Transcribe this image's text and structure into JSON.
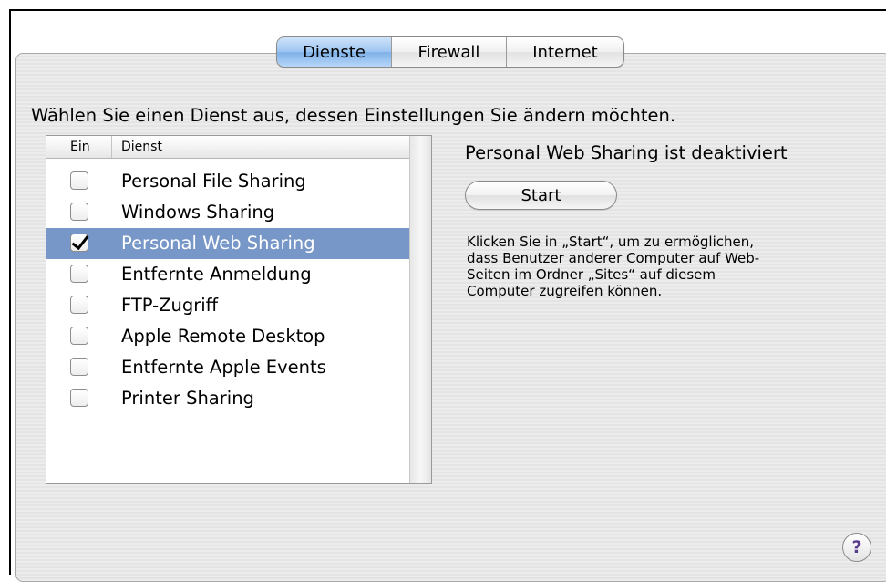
{
  "tabs": [
    {
      "label": "Dienste",
      "active": true
    },
    {
      "label": "Firewall",
      "active": false
    },
    {
      "label": "Internet",
      "active": false
    }
  ],
  "heading": "Wählen Sie einen Dienst aus, dessen Einstellungen Sie ändern möchten.",
  "list": {
    "columns": {
      "on": "Ein",
      "service": "Dienst"
    },
    "items": [
      {
        "label": "Personal File Sharing",
        "checked": false,
        "selected": false
      },
      {
        "label": "Windows Sharing",
        "checked": false,
        "selected": false
      },
      {
        "label": "Personal Web Sharing",
        "checked": true,
        "selected": true
      },
      {
        "label": "Entfernte Anmeldung",
        "checked": false,
        "selected": false
      },
      {
        "label": "FTP-Zugriff",
        "checked": false,
        "selected": false
      },
      {
        "label": "Apple Remote Desktop",
        "checked": false,
        "selected": false
      },
      {
        "label": "Entfernte Apple Events",
        "checked": false,
        "selected": false
      },
      {
        "label": "Printer Sharing",
        "checked": false,
        "selected": false
      }
    ]
  },
  "detail": {
    "status": "Personal Web Sharing ist deaktiviert",
    "start_label": "Start",
    "description_lines": [
      "Klicken Sie in „Start“, um zu ermöglichen,",
      "dass Benutzer anderer Computer auf Web-",
      "Seiten im Ordner „Sites“ auf diesem",
      "Computer zugreifen können."
    ]
  },
  "help": {
    "label": "?",
    "icon": "help-icon"
  },
  "colors": {
    "selection": "#7697c7",
    "tab_active": "#9cc4ef",
    "help_glyph": "#5a3a8a"
  }
}
